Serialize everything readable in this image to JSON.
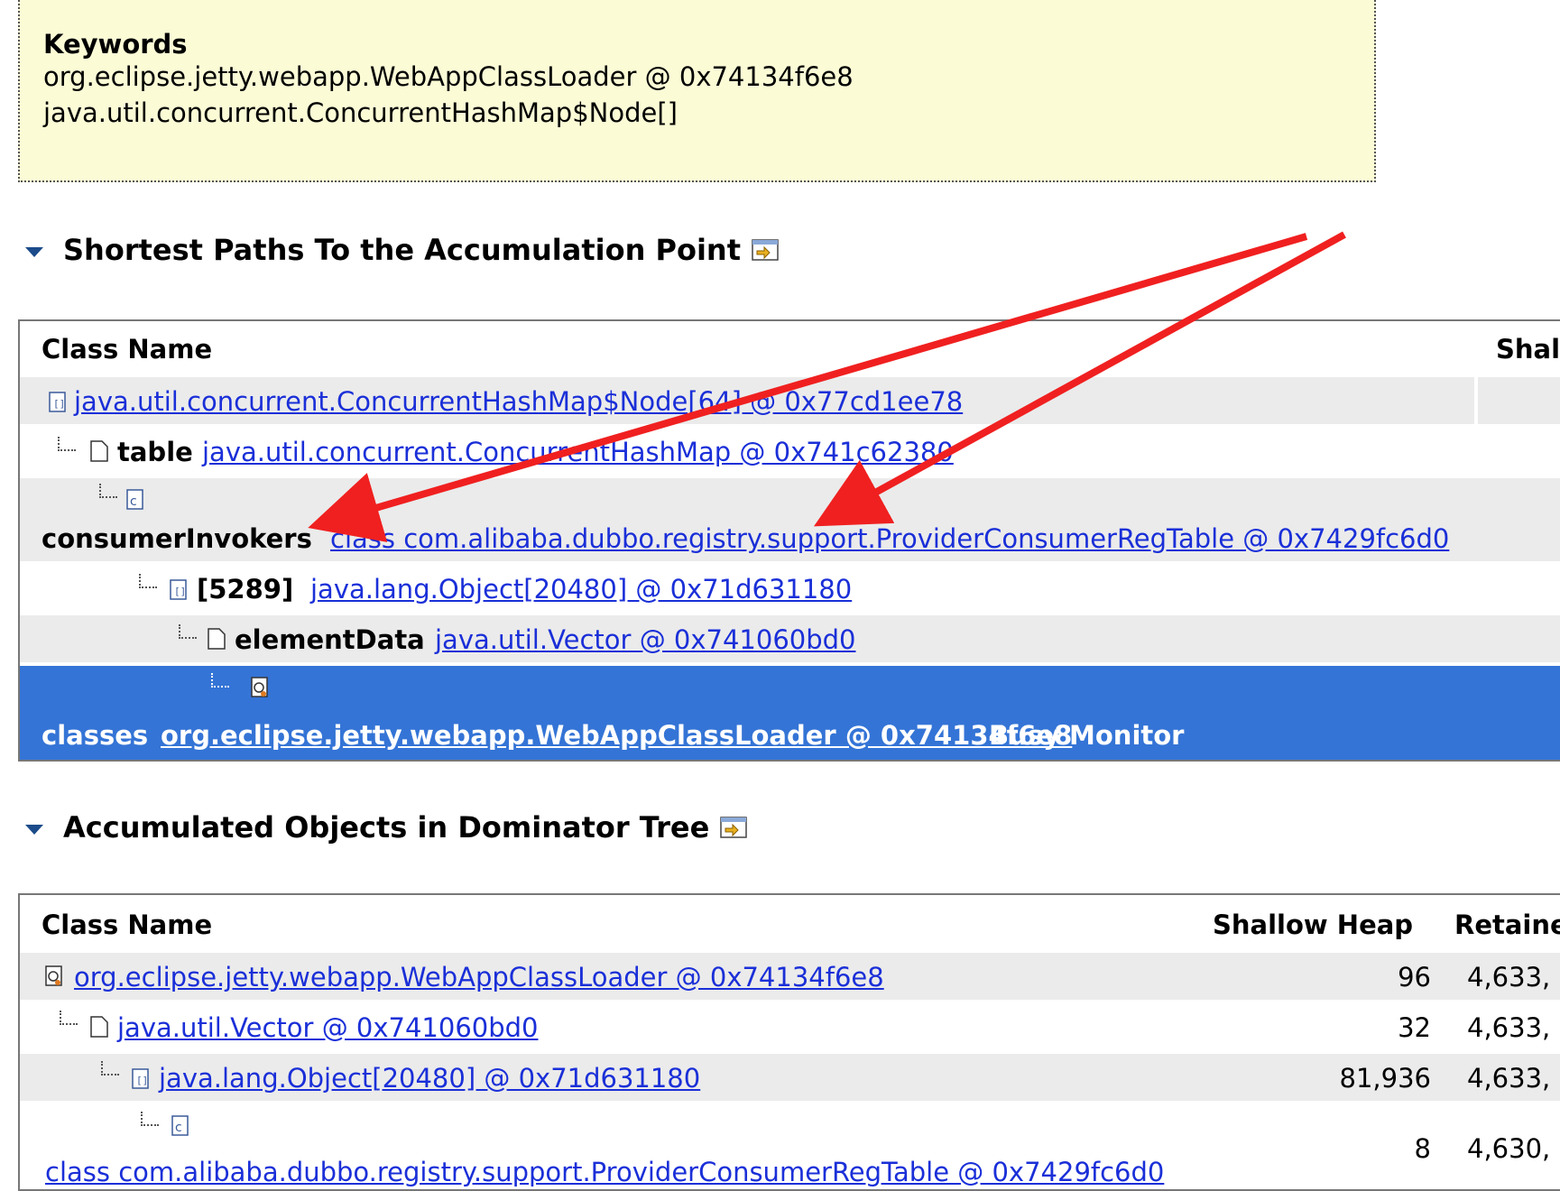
{
  "keywords": {
    "title": "Keywords",
    "lines": [
      "org.eclipse.jetty.webapp.WebAppClassLoader @ 0x74134f6e8",
      "java.util.concurrent.ConcurrentHashMap$Node[]"
    ]
  },
  "paths_section": {
    "title": "Shortest Paths To the Accumulation Point",
    "headers": [
      "Class Name",
      "Shal"
    ],
    "rows": [
      {
        "field": "",
        "link": "java.util.concurrent.ConcurrentHashMap$Node[64] @ 0x77cd1ee78",
        "suffix": ""
      },
      {
        "field": "table",
        "link": "java.util.concurrent.ConcurrentHashMap @ 0x741c62380",
        "suffix": ""
      },
      {
        "field": "consumerInvokers",
        "link": "class com.alibaba.dubbo.registry.support.ProviderConsumerRegTable @ 0x7429fc6d0",
        "suffix": ""
      },
      {
        "field": "[5289]",
        "link": "java.lang.Object[20480] @ 0x71d631180",
        "suffix": ""
      },
      {
        "field": "elementData",
        "link": "java.util.Vector @ 0x741060bd0",
        "suffix": ""
      },
      {
        "field": "classes",
        "link": "org.eclipse.jetty.webapp.WebAppClassLoader @ 0x74134f6e8",
        "suffix": "Busy Monitor"
      }
    ]
  },
  "dominator_section": {
    "title": "Accumulated Objects in Dominator Tree",
    "headers": [
      "Class Name",
      "Shallow Heap",
      "Retaine"
    ],
    "rows": [
      {
        "link": "org.eclipse.jetty.webapp.WebAppClassLoader @ 0x74134f6e8",
        "shallow": "96",
        "retained": "4,633,"
      },
      {
        "link": "java.util.Vector @ 0x741060bd0",
        "shallow": "32",
        "retained": "4,633,"
      },
      {
        "link": "java.lang.Object[20480] @ 0x71d631180",
        "shallow": "81,936",
        "retained": "4,633,"
      },
      {
        "link": "class com.alibaba.dubbo.registry.support.ProviderConsumerRegTable @ 0x7429fc6d0",
        "shallow": "8",
        "retained": "4,630,"
      }
    ]
  },
  "colors": {
    "keywords_bg": "#fbfbd6",
    "link": "#1a2fd8",
    "selected_row": "#3474d6",
    "alt_row": "#ebebeb",
    "annotation_arrow": "#f02020"
  },
  "icons": [
    "array-icon",
    "object-icon",
    "class-icon",
    "classloader-icon",
    "export-icon",
    "collapse-triangle-icon"
  ]
}
